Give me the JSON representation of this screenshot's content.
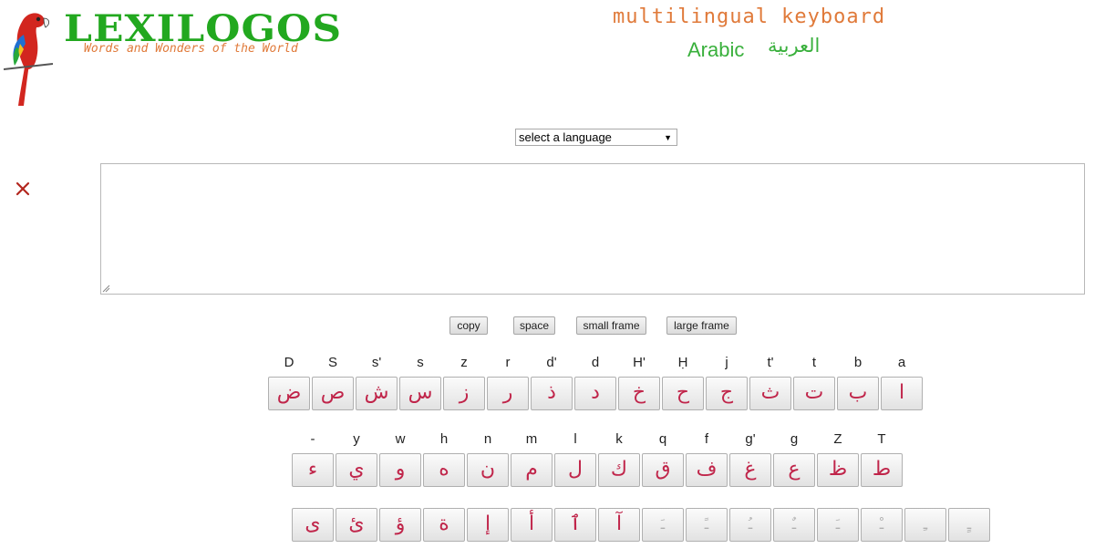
{
  "header": {
    "logo_text": "LEXILOGOS",
    "tagline": "Words and Wonders of the World",
    "title": "multilingual keyboard",
    "subtitle": "Arabic",
    "subtitle_native": "العربية"
  },
  "language_select": {
    "value": "select a language"
  },
  "buttons": {
    "copy": "copy",
    "space": "space",
    "small_frame": "small frame",
    "large_frame": "large frame"
  },
  "keyboard": {
    "row1": [
      {
        "label": "D",
        "char": "ض"
      },
      {
        "label": "S",
        "char": "ص"
      },
      {
        "label": "s'",
        "char": "ش"
      },
      {
        "label": "s",
        "char": "س"
      },
      {
        "label": "z",
        "char": "ز"
      },
      {
        "label": "r",
        "char": "ر"
      },
      {
        "label": "d'",
        "char": "ذ"
      },
      {
        "label": "d",
        "char": "د"
      },
      {
        "label": "H'",
        "char": "خ"
      },
      {
        "label": "Ḥ",
        "char": "ح"
      },
      {
        "label": "j",
        "char": "ج"
      },
      {
        "label": "t'",
        "char": "ث"
      },
      {
        "label": "t",
        "char": "ت"
      },
      {
        "label": "b",
        "char": "ب"
      },
      {
        "label": "a",
        "char": "ا"
      }
    ],
    "row2": [
      {
        "label": "-",
        "char": "ء"
      },
      {
        "label": "y",
        "char": "ي"
      },
      {
        "label": "w",
        "char": "و"
      },
      {
        "label": "h",
        "char": "ه"
      },
      {
        "label": "n",
        "char": "ن"
      },
      {
        "label": "m",
        "char": "م"
      },
      {
        "label": "l",
        "char": "ل"
      },
      {
        "label": "k",
        "char": "ك"
      },
      {
        "label": "q",
        "char": "ق"
      },
      {
        "label": "f",
        "char": "ف"
      },
      {
        "label": "g'",
        "char": "غ"
      },
      {
        "label": "g",
        "char": "ع"
      },
      {
        "label": "Z",
        "char": "ظ"
      },
      {
        "label": "T",
        "char": "ط"
      }
    ],
    "row3": [
      {
        "char": "ى"
      },
      {
        "char": "ئ"
      },
      {
        "char": "ؤ"
      },
      {
        "char": "ة"
      },
      {
        "char": "إ"
      },
      {
        "char": "أ"
      },
      {
        "char": "ٱ"
      },
      {
        "char": "آ"
      },
      {
        "char": "ـَ"
      },
      {
        "char": "ـً"
      },
      {
        "char": "ـُ"
      },
      {
        "char": "ـٌ"
      },
      {
        "char": "ـَ"
      },
      {
        "char": "ـْ"
      },
      {
        "char": "ـِ"
      },
      {
        "char": "ـٍ"
      }
    ]
  }
}
